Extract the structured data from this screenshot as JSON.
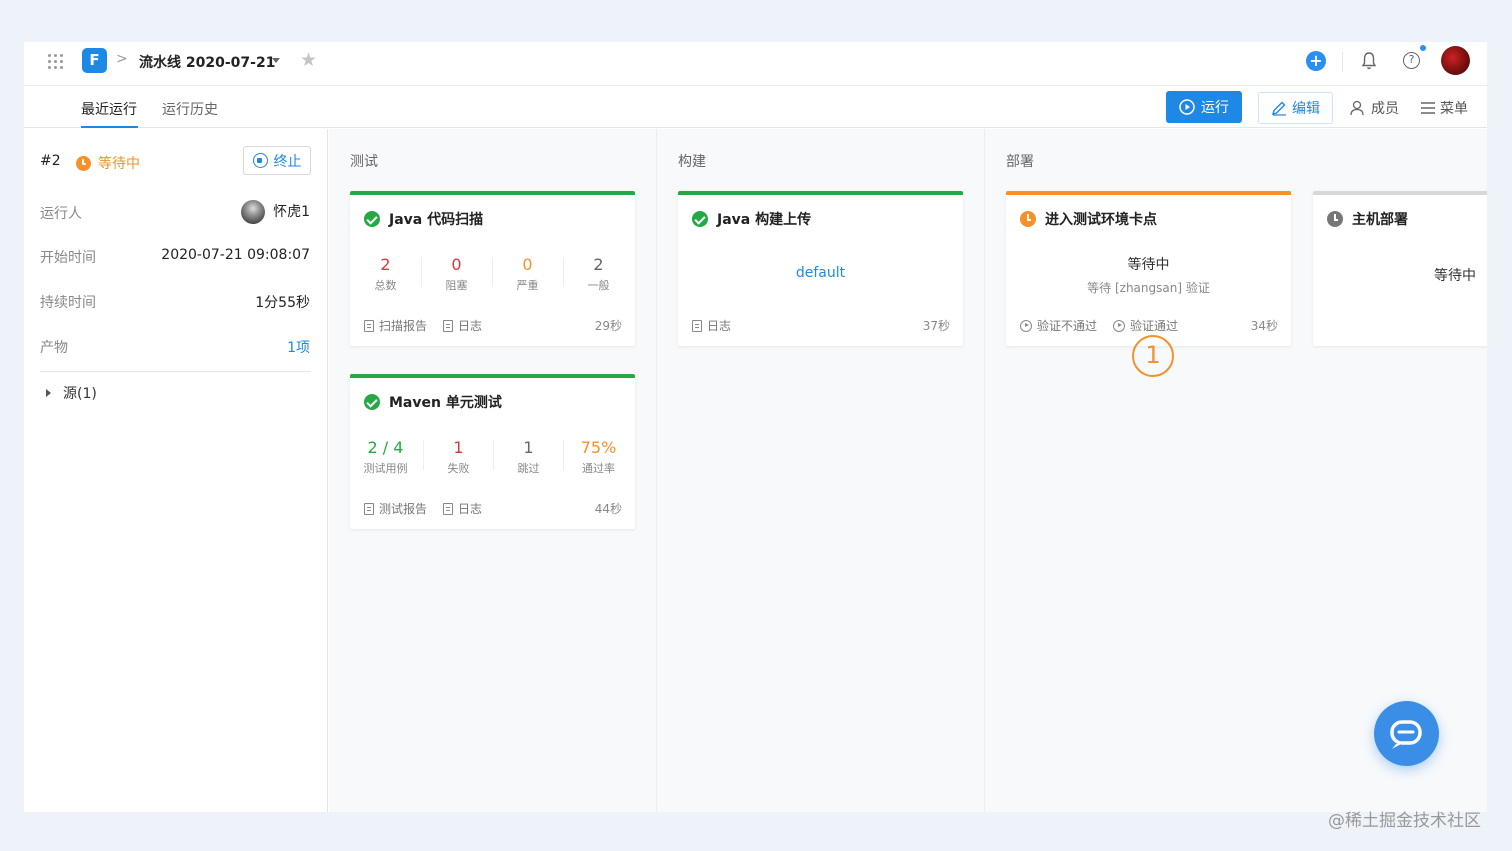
{
  "header": {
    "logo_letter": "F",
    "breadcrumb_sep": ">",
    "pipeline_title": "流水线 2020-07-21",
    "plus_label": "+",
    "help_label": "?"
  },
  "tabs": [
    {
      "label": "最近运行",
      "active": true
    },
    {
      "label": "运行历史",
      "active": false
    }
  ],
  "actions": {
    "run": "运行",
    "edit": "编辑",
    "members": "成员",
    "menu": "菜单"
  },
  "run_info": {
    "number": "#2",
    "status": "等待中",
    "stop_label": "终止",
    "rows": [
      {
        "label": "运行人",
        "value": "怀虎1"
      },
      {
        "label": "开始时间",
        "value": "2020-07-21 09:08:07"
      },
      {
        "label": "持续时间",
        "value": "1分55秒"
      },
      {
        "label": "产物",
        "value": "1项"
      }
    ],
    "source_label": "源(1)"
  },
  "stages": [
    {
      "name": "测试",
      "jobs": [
        {
          "title": "Java 代码扫描",
          "status": "success",
          "stats": [
            {
              "value": "2",
              "label": "总数",
              "color": "#d9383a"
            },
            {
              "value": "0",
              "label": "阻塞",
              "color": "#d9383a"
            },
            {
              "value": "0",
              "label": "严重",
              "color": "#f5902a"
            },
            {
              "value": "2",
              "label": "一般",
              "color": "#666666"
            }
          ],
          "links": [
            "扫描报告",
            "日志"
          ],
          "duration": "29秒"
        },
        {
          "title": "Maven 单元测试",
          "status": "success",
          "stats": [
            {
              "value": "2 / 4",
              "label": "测试用例",
              "color": "#26a944"
            },
            {
              "value": "1",
              "label": "失败",
              "color": "#d9383a"
            },
            {
              "value": "1",
              "label": "跳过",
              "color": "#666666"
            },
            {
              "value": "75%",
              "label": "通过率",
              "color": "#f5902a"
            }
          ],
          "links": [
            "测试报告",
            "日志"
          ],
          "duration": "44秒"
        }
      ]
    },
    {
      "name": "构建",
      "jobs": [
        {
          "title": "Java 构建上传",
          "status": "success",
          "artifact": "default",
          "links": [
            "日志"
          ],
          "duration": "37秒"
        }
      ]
    },
    {
      "name": "部署",
      "jobs": [
        {
          "title": "进入测试环境卡点",
          "status": "waiting",
          "state_text": "等待中",
          "state_sub": "等待 [zhangsan] 验证",
          "links": [
            "验证不通过",
            "验证通过"
          ],
          "duration": "34秒"
        },
        {
          "title": "主机部署",
          "status": "pending",
          "state_text": "等待中"
        }
      ]
    }
  ],
  "annotation": "1",
  "watermark": "@稀土掘金技术社区",
  "colors": {
    "primary": "#1e88e5",
    "success": "#26a944",
    "warning": "#f5902a",
    "danger": "#d9383a"
  }
}
